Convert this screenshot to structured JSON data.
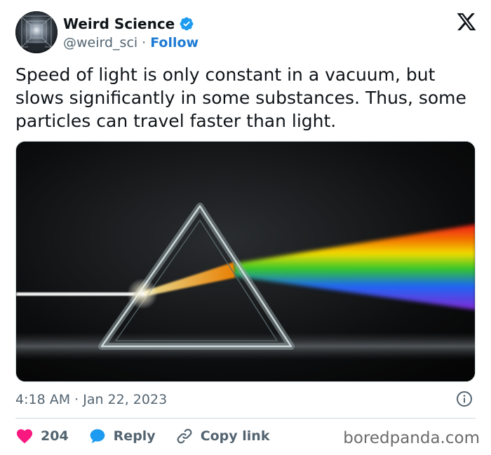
{
  "author": {
    "display_name": "Weird Science",
    "handle": "@weird_sci",
    "separator": "·",
    "follow_label": "Follow",
    "verified": true,
    "avatar_icon": "tunnel-avatar-icon"
  },
  "tweet": {
    "text": "Speed of light is only constant in a vacuum, but slows significantly in some substances. Thus, some particles can travel faster than light.",
    "timestamp": "4:18 AM · Jan 22, 2023"
  },
  "actions": {
    "like_count": "204",
    "reply_label": "Reply",
    "copy_label": "Copy link"
  },
  "watermark": "boredpanda.com",
  "colors": {
    "accent": "#1d9bf0",
    "follow": "#1d7bd4",
    "like": "#f91880",
    "secondary_text": "#536471"
  }
}
